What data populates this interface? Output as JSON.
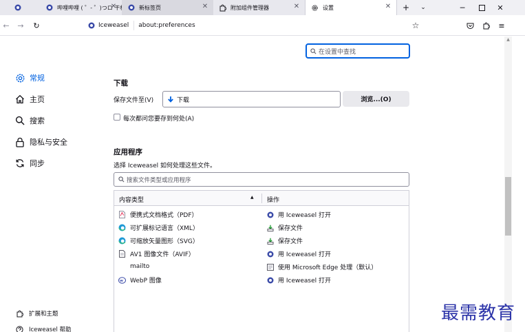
{
  "tabs": [
    {
      "title": "",
      "icon": "iceweasel-icon"
    },
    {
      "title": "哔哩哔哩 ( ゜- ゜)つロ 干杯~",
      "icon": "iceweasel-icon"
    },
    {
      "title": "新标签页",
      "icon": "iceweasel-icon"
    },
    {
      "title": "附加组件管理器",
      "icon": "puzzle-icon"
    },
    {
      "title": "设置",
      "icon": "gear-icon"
    }
  ],
  "urlbar": {
    "brand": "Iceweasel",
    "url": "about:preferences"
  },
  "search_prefs_placeholder": "在设置中查找",
  "sidebar": {
    "items": [
      {
        "label": "常规",
        "icon": "gear-icon"
      },
      {
        "label": "主页",
        "icon": "home-icon"
      },
      {
        "label": "搜索",
        "icon": "search-icon"
      },
      {
        "label": "隐私与安全",
        "icon": "lock-icon"
      },
      {
        "label": "同步",
        "icon": "sync-icon"
      }
    ],
    "footer": [
      {
        "label": "扩展和主题",
        "icon": "puzzle-icon"
      },
      {
        "label": "Iceweasel 帮助",
        "icon": "help-icon"
      }
    ]
  },
  "downloads": {
    "heading": "下载",
    "save_to_label": "保存文件至(V)",
    "folder": "下载",
    "browse_label": "浏览...(O)",
    "always_ask_label": "每次都问您要存到何处(A)",
    "always_ask_checked": false
  },
  "applications": {
    "heading": "应用程序",
    "description": "选择 Iceweasel 如何处理这些文件。",
    "search_placeholder": "搜索文件类型或应用程序",
    "columns": [
      "内容类型",
      "操作"
    ],
    "rows": [
      {
        "type": "便携式文档格式（PDF）",
        "type_icon": "pdf-icon",
        "action": "用 Iceweasel 打开",
        "action_icon": "iceweasel-icon"
      },
      {
        "type": "可扩展标记语言（XML）",
        "type_icon": "edge-icon",
        "action": "保存文件",
        "action_icon": "save-icon"
      },
      {
        "type": "可缩放矢量图形（SVG）",
        "type_icon": "edge-icon",
        "action": "保存文件",
        "action_icon": "save-icon"
      },
      {
        "type": "AV1 图像文件（AVIF）",
        "type_icon": "file-icon",
        "action": "用 Iceweasel 打开",
        "action_icon": "iceweasel-icon"
      },
      {
        "type": "mailto",
        "type_icon": "",
        "action": "使用 Microsoft Edge 处理（默认）",
        "action_icon": "app-icon"
      },
      {
        "type": "WebP 图像",
        "type_icon": "webp-icon",
        "action": "用 Iceweasel 打开",
        "action_icon": "iceweasel-icon"
      }
    ]
  },
  "watermark": "最需教育",
  "colors": {
    "accent": "#0061e0",
    "watermark": "#2b33a8"
  }
}
